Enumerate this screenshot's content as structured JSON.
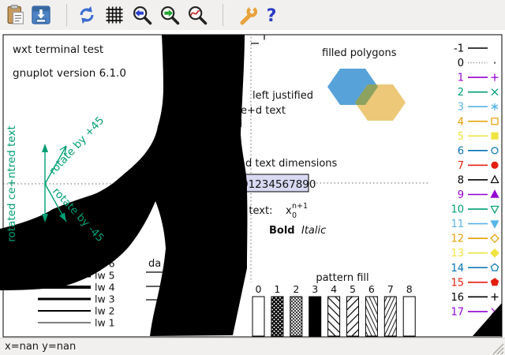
{
  "toolbar": {
    "buttons": [
      {
        "name": "copy-to-clipboard",
        "icon": "clipboard-icon"
      },
      {
        "name": "export-plot",
        "icon": "export-icon"
      },
      {
        "name": "replot",
        "icon": "refresh-icon"
      },
      {
        "name": "toggle-grid",
        "icon": "grid-icon"
      },
      {
        "name": "zoom-previous",
        "icon": "zoom-previous-icon"
      },
      {
        "name": "zoom-next",
        "icon": "zoom-next-icon"
      },
      {
        "name": "apply-autoscale",
        "icon": "zoom-autoscale-icon"
      },
      {
        "name": "configure-terminal",
        "icon": "wrench-icon"
      },
      {
        "name": "help",
        "icon": "help-icon"
      }
    ],
    "help_glyph": "?"
  },
  "plot": {
    "header": [
      "wxt  terminal test",
      "gnuplot version 6.1.0"
    ],
    "ticscale_fragment": "le",
    "filled_polygons_label": "filled polygons",
    "polygons": {
      "blue": "#57a2d9",
      "yellow": "#ecc878",
      "overlap": "#8da25f"
    },
    "justified_fragments": {
      "left": "left justified",
      "centre": "e+d text",
      "right": "d"
    },
    "dimensions_fragment": "d text dimensions",
    "boxed_digits": "01234567890",
    "box_fill": "#d9d9f3",
    "enhanced": {
      "prefix": "d text:",
      "base": "x",
      "superscript": "n+1",
      "subscript": "0"
    },
    "bold_label": "Bold",
    "italic_label": "Italic",
    "rotation": {
      "vertical": "rotated ce+ntred text",
      "plus45": "rotate by +45",
      "minus45": "rotate by -45",
      "color": "#009e73"
    },
    "dash_fragment": "da",
    "linewidths": [
      {
        "label": "lw 1",
        "width": 1
      },
      {
        "label": "lw 2",
        "width": 2
      },
      {
        "label": "lw 3",
        "width": 3
      },
      {
        "label": "lw 4",
        "width": 4
      },
      {
        "label": "lw 5",
        "width": 5
      },
      {
        "label": "lw 6",
        "width": 6
      }
    ],
    "pattern": {
      "title": "pattern fill",
      "bars": [
        {
          "label": "0",
          "fill": "empty"
        },
        {
          "label": "1",
          "fill": "crosshatch-heavy"
        },
        {
          "label": "2",
          "fill": "crosshatch-fine"
        },
        {
          "label": "3",
          "fill": "solid"
        },
        {
          "label": "4",
          "fill": "diagonal-backslash"
        },
        {
          "label": "5",
          "fill": "diagonal-slash"
        },
        {
          "label": "6",
          "fill": "steep-backslash"
        },
        {
          "label": "7",
          "fill": "steep-slash"
        },
        {
          "label": "8",
          "fill": "empty"
        }
      ]
    },
    "linetypes": [
      {
        "label": "-1",
        "color": "#000000",
        "label_color": "#000000",
        "line": "solid",
        "point": "none"
      },
      {
        "label": "0",
        "color": "#888888",
        "label_color": "#000000",
        "line": "dotted",
        "point": "dot"
      },
      {
        "label": "1",
        "color": "#9400d3",
        "line": "solid",
        "point": "plus"
      },
      {
        "label": "2",
        "color": "#009e73",
        "line": "solid",
        "point": "cross"
      },
      {
        "label": "3",
        "color": "#56b4e9",
        "line": "solid",
        "point": "asterisk"
      },
      {
        "label": "4",
        "color": "#e69f00",
        "line": "solid",
        "point": "square-open"
      },
      {
        "label": "5",
        "color": "#f0e442",
        "line": "solid",
        "point": "square-filled"
      },
      {
        "label": "6",
        "color": "#0072b2",
        "line": "solid",
        "point": "circle-open"
      },
      {
        "label": "7",
        "color": "#e51e10",
        "line": "solid",
        "point": "circle-filled"
      },
      {
        "label": "8",
        "color": "#000000",
        "line": "solid",
        "point": "triangle-up-open"
      },
      {
        "label": "9",
        "color": "#9400d3",
        "line": "solid",
        "point": "triangle-up-filled"
      },
      {
        "label": "10",
        "color": "#009e73",
        "line": "solid",
        "point": "triangle-down-open"
      },
      {
        "label": "11",
        "color": "#56b4e9",
        "line": "solid",
        "point": "triangle-down-filled"
      },
      {
        "label": "12",
        "color": "#e69f00",
        "line": "solid",
        "point": "diamond-open"
      },
      {
        "label": "13",
        "color": "#f0e442",
        "line": "solid",
        "point": "diamond-filled"
      },
      {
        "label": "14",
        "color": "#0072b2",
        "line": "solid",
        "point": "pentagon-open"
      },
      {
        "label": "15",
        "color": "#e51e10",
        "line": "solid",
        "point": "pentagon-filled"
      },
      {
        "label": "16",
        "color": "#000000",
        "line": "solid",
        "point": "plus"
      },
      {
        "label": "17",
        "color": "#9400d3",
        "line": "solid",
        "point": "cross"
      }
    ]
  },
  "statusbar": {
    "text": "x=nan y=nan"
  }
}
